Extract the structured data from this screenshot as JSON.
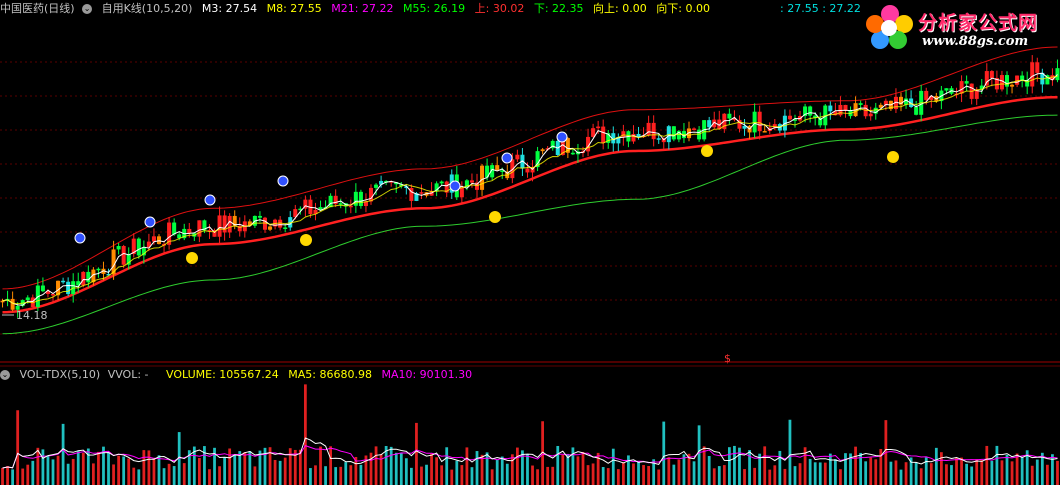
{
  "top_header": {
    "stock": "中国医药(日线)",
    "indicator": "自用K线(10,5,20)",
    "m3": "M3: 27.54",
    "m8": "M8: 27.55",
    "m21": "M21: 27.22",
    "m55": "M55: 26.19",
    "up": "上: 30.02",
    "down": "下: 22.35",
    "xiang_shang": "向上: 0.00",
    "xiang_xia": "向下: 0.00",
    "right_vals": ": 27.55 : 27.22"
  },
  "vol_header": {
    "name": "VOL-TDX(5,10)",
    "vvol": "VVOL: -",
    "volume": "VOLUME: 105567.24",
    "ma5": "MA5: 86680.98",
    "ma10": "MA10: 90101.30"
  },
  "price_low_label": "14.18",
  "dollar_marker": "$",
  "logo": {
    "main": "分析家公式网",
    "url": "www.88gs.com"
  },
  "colors": {
    "m3": "#ffffff",
    "m8": "#ffff00",
    "m21": "#ff00ff",
    "m55": "#00ff00",
    "up": "#ff3030",
    "down": "#00ff00",
    "header_text": "#c0c0c0",
    "ma21_line": "#ff2020",
    "ma55_line": "#2ecc2e",
    "band": "#dd1010",
    "vol_up": "#e02020",
    "vol_down": "#20c0c0",
    "ma5_vol": "#ffffff",
    "ma10_vol": "#ff00ff"
  },
  "chart_data": {
    "type": "candlestick",
    "title": "中国医药(日线)",
    "price_range": [
      14.18,
      30.02
    ],
    "annotations": [
      "14.18"
    ],
    "indicators": {
      "M3": 27.54,
      "M8": 27.55,
      "M21": 27.22,
      "M55": 26.19,
      "上": 30.02,
      "下": 22.35,
      "向上": 0.0,
      "向下": 0.0
    },
    "ma_trend": {
      "x": [
        0,
        20,
        40,
        60,
        80,
        100
      ],
      "ma21": [
        15.2,
        19.0,
        21.0,
        24.2,
        25.4,
        27.2
      ],
      "ma55": [
        14.0,
        17.0,
        20.0,
        21.5,
        24.8,
        26.2
      ],
      "upper_band": [
        16.5,
        21.0,
        23.2,
        26.5,
        27.0,
        30.0
      ]
    },
    "volume_panel": {
      "VOLUME": 105567.24,
      "MA5": 86680.98,
      "MA10": 90101.3
    }
  }
}
